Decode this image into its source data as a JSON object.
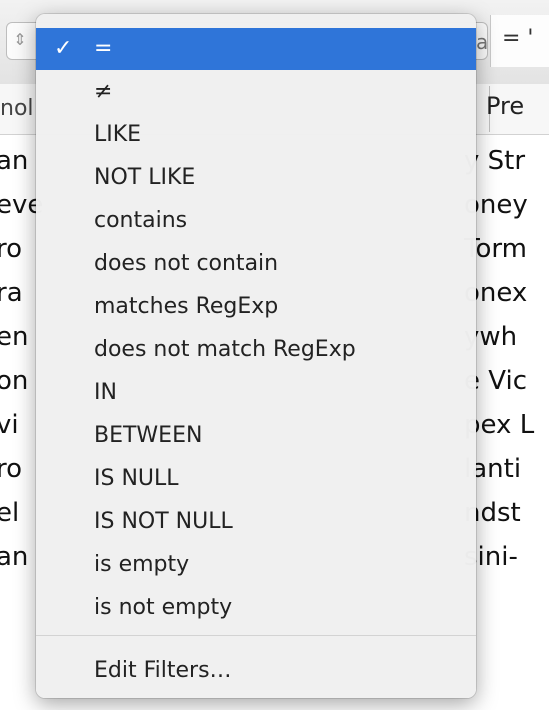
{
  "background": {
    "right_field_text": "= '",
    "right_field_left_glyph": "a",
    "left_header": "nol",
    "right_header": "Pre",
    "rows": [
      {
        "left": "an",
        "right": "y Str"
      },
      {
        "left": "eve",
        "right": "oney"
      },
      {
        "left": "ro",
        "right": "Torm"
      },
      {
        "left": "ra",
        "right": "onex"
      },
      {
        "left": "en",
        "right": "ywh"
      },
      {
        "left": "on",
        "right": "e Vic"
      },
      {
        "left": "vi",
        "right": "pex L"
      },
      {
        "left": "ro",
        "right": "lanti"
      },
      {
        "left": "el",
        "right": "ndst"
      },
      {
        "left": "an",
        "right": "sini-"
      }
    ]
  },
  "menu": {
    "check_glyph": "✓",
    "items": [
      {
        "label": "=",
        "selected": true
      },
      {
        "label": "≠"
      },
      {
        "label": "LIKE"
      },
      {
        "label": "NOT LIKE"
      },
      {
        "label": "contains"
      },
      {
        "label": "does not contain"
      },
      {
        "label": "matches RegExp"
      },
      {
        "label": "does not match RegExp"
      },
      {
        "label": "IN"
      },
      {
        "label": "BETWEEN"
      },
      {
        "label": "IS NULL"
      },
      {
        "label": "IS NOT NULL"
      },
      {
        "label": "is empty"
      },
      {
        "label": "is not empty"
      }
    ],
    "footer_item": "Edit Filters…"
  },
  "colors": {
    "selection": "#2f75d9",
    "menu_bg": "#f0f0f0"
  }
}
